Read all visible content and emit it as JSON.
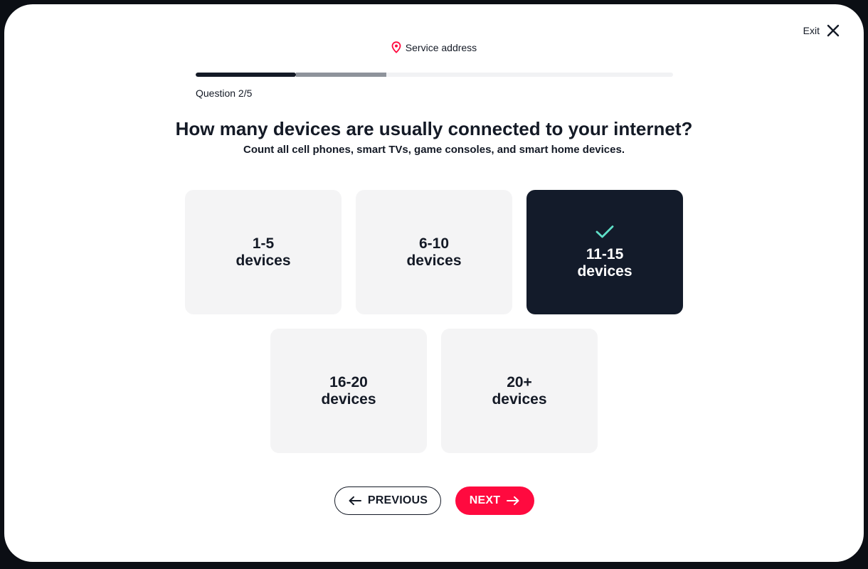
{
  "header": {
    "exit_label": "Exit",
    "service_address_label": "Service address"
  },
  "progress": {
    "question_label": "Question 2/5",
    "completed_fraction": 0.21,
    "current_fraction": 0.4
  },
  "question": {
    "title": "How many devices are usually connected to your internet?",
    "subtitle": "Count all cell phones, smart TVs, game consoles, and smart home devices."
  },
  "options": [
    {
      "range": "1-5",
      "unit": "devices",
      "selected": false
    },
    {
      "range": "6-10",
      "unit": "devices",
      "selected": false
    },
    {
      "range": "11-15",
      "unit": "devices",
      "selected": true
    },
    {
      "range": "16-20",
      "unit": "devices",
      "selected": false
    },
    {
      "range": "20+",
      "unit": "devices",
      "selected": false
    }
  ],
  "navigation": {
    "previous_label": "PREVIOUS",
    "next_label": "NEXT"
  },
  "colors": {
    "accent": "#ff0a3f",
    "dark": "#141a26",
    "selected_bg": "#131b2a",
    "check": "#5fe0c8",
    "option_bg": "#f4f4f5"
  },
  "icons": {
    "exit": "close-icon",
    "service": "location-pin-icon",
    "selected": "checkmark-icon",
    "previous": "arrow-left-icon",
    "next": "arrow-right-icon"
  }
}
